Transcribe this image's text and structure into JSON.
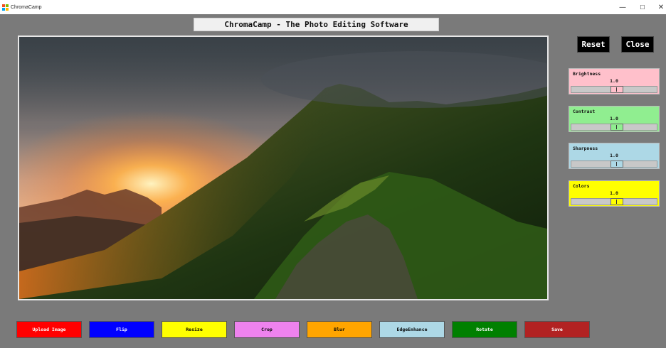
{
  "window": {
    "title": "ChromaCamp",
    "minimize_glyph": "—",
    "maximize_glyph": "☐",
    "close_glyph": "✕"
  },
  "header": {
    "title": "ChromaCamp - The Photo Editing Software"
  },
  "top_buttons": {
    "reset_label": "Reset",
    "close_label": "Close"
  },
  "sliders": [
    {
      "label": "Brightness",
      "value": "1.0",
      "bg": "#ffc0cb",
      "thumb": "#ffc0cb",
      "level": 0.5
    },
    {
      "label": "Contrast",
      "value": "1.0",
      "bg": "#90ee90",
      "thumb": "#90ee90",
      "level": 0.5
    },
    {
      "label": "Sharpness",
      "value": "1.0",
      "bg": "#add8e6",
      "thumb": "#add8e6",
      "level": 0.5
    },
    {
      "label": "Colors",
      "value": "1.0",
      "bg": "#ffff00",
      "thumb": "#ffff00",
      "level": 0.5
    }
  ],
  "bottom_buttons": [
    {
      "label": "Upload Image",
      "bg": "#ff0000",
      "fg": "#ffffff"
    },
    {
      "label": "Flip",
      "bg": "#0000ff",
      "fg": "#ffffff"
    },
    {
      "label": "Resize",
      "bg": "#ffff00",
      "fg": "#000000"
    },
    {
      "label": "Crop",
      "bg": "#ee82ee",
      "fg": "#000000"
    },
    {
      "label": "Blur",
      "bg": "#ffa500",
      "fg": "#000000"
    },
    {
      "label": "EdgeEnhance",
      "bg": "#add8e6",
      "fg": "#000000"
    },
    {
      "label": "Rotate",
      "bg": "#008000",
      "fg": "#ffffff"
    },
    {
      "label": "Save",
      "bg": "#b22222",
      "fg": "#ffffff"
    }
  ]
}
